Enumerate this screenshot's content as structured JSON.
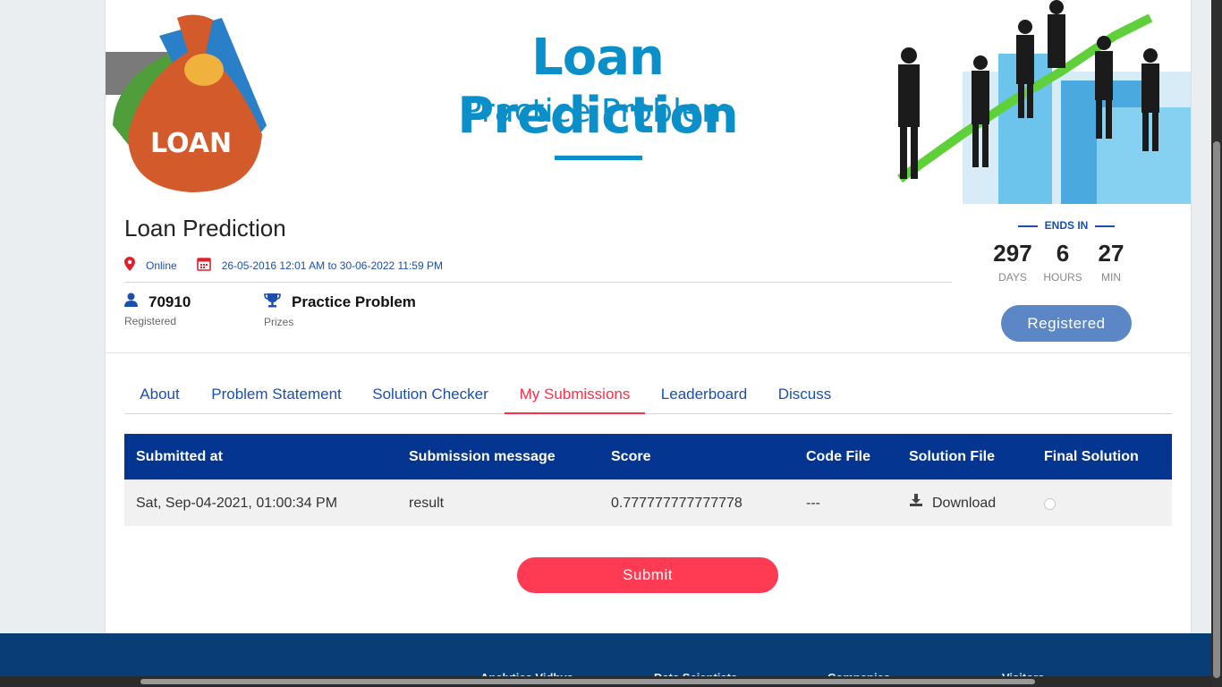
{
  "banner": {
    "title": "Loan Prediction",
    "subtitle": "Practice Problem",
    "bag_text": "LOAN",
    "colors": {
      "brand_blue": "#0b8fc9",
      "bag": "#d35a2b"
    }
  },
  "contest": {
    "title": "Loan Prediction",
    "mode": "Online",
    "dates": "26-05-2016 12:01 AM to 30-06-2022 11:59 PM",
    "registered_count": "70910",
    "registered_label": "Registered",
    "prize": "Practice Problem",
    "prize_label": "Prizes"
  },
  "countdown": {
    "heading": "ENDS IN",
    "days": "297",
    "days_label": "DAYS",
    "hours": "6",
    "hours_label": "HOURS",
    "min": "27",
    "min_label": "MIN"
  },
  "register_button": "Registered",
  "tabs": [
    {
      "label": "About"
    },
    {
      "label": "Problem Statement"
    },
    {
      "label": "Solution Checker"
    },
    {
      "label": "My Submissions",
      "active": true
    },
    {
      "label": "Leaderboard"
    },
    {
      "label": "Discuss"
    }
  ],
  "table": {
    "headers": [
      "Submitted at",
      "Submission message",
      "Score",
      "Code File",
      "Solution File",
      "Final Solution"
    ],
    "rows": [
      {
        "submitted_at": "Sat, Sep-04-2021, 01:00:34 PM",
        "message": "result",
        "score": "0.777777777777778",
        "code_file": "---",
        "solution_file": "Download",
        "final_solution": false
      }
    ]
  },
  "submit_button": "Submit",
  "footer": {
    "columns": [
      "Analytics Vidhya",
      "Data Scientists",
      "Companies",
      "Visitors"
    ]
  },
  "colors": {
    "header_blue": "#043591",
    "accent_red": "#ff2e48",
    "link_blue": "#1a4fae",
    "footer": "#093d76"
  }
}
